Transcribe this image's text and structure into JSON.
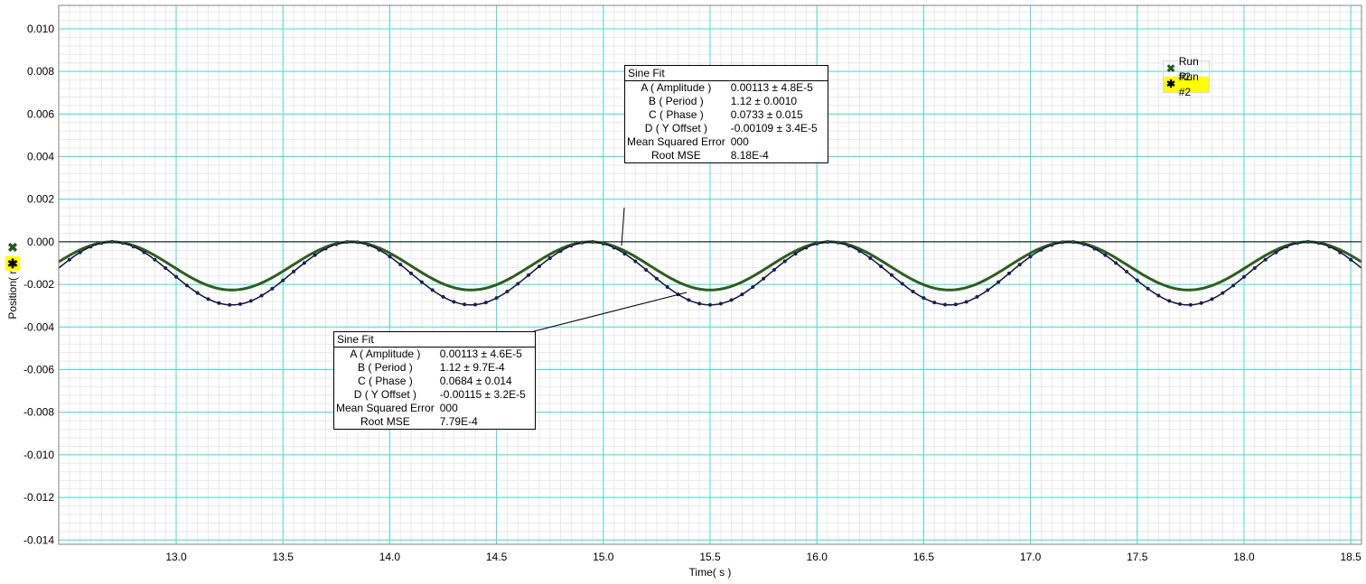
{
  "chart_data": {
    "type": "scatter",
    "xlabel": "Time( s )",
    "ylabel": "Position( m )",
    "xlim": [
      12.45,
      18.55
    ],
    "ylim": [
      -0.0142,
      0.0111
    ],
    "x_ticks": [
      13.0,
      13.5,
      14.0,
      14.5,
      15.0,
      15.5,
      16.0,
      16.5,
      17.0,
      17.5,
      18.0,
      18.5
    ],
    "y_ticks": [
      0.01,
      0.008,
      0.006,
      0.004,
      0.002,
      0.0,
      -0.002,
      -0.004,
      -0.006,
      -0.008,
      -0.01,
      -0.012,
      -0.014
    ],
    "x_tick_labels": [
      "13.0",
      "13.5",
      "14.0",
      "14.5",
      "15.0",
      "15.5",
      "16.0",
      "16.5",
      "17.0",
      "17.5",
      "18.0",
      "18.5"
    ],
    "y_tick_labels": [
      "0.010",
      "0.008",
      "0.006",
      "0.004",
      "0.002",
      "0.000",
      "-0.002",
      "-0.004",
      "-0.006",
      "-0.008",
      "-0.010",
      "-0.012",
      "-0.014"
    ],
    "grid": true,
    "legend_position": "top-right",
    "series": [
      {
        "name": "Run #2",
        "marker": "x",
        "color": "#1f5a1f",
        "fit": {
          "A": 0.00113,
          "B": 1.12,
          "C": 0.0733,
          "D": -0.00109,
          "x0": 12.7,
          "phase_sign": "peak"
        }
      },
      {
        "name": "Run #2",
        "marker": "asterisk",
        "color": "#1a1a66",
        "fit": {
          "A": 0.00113,
          "B": 1.12,
          "C": 0.0684,
          "D": -0.00115,
          "x0": 12.7,
          "phase_sign": "peak",
          "trough_extra": 0.0007
        }
      }
    ]
  },
  "fit_upper": {
    "title": "Sine Fit",
    "rows": [
      {
        "name": "A ( Amplitude )",
        "value": "0.00113 ± 4.8E-5"
      },
      {
        "name": "B ( Period )",
        "value": "1.12 ± 0.0010"
      },
      {
        "name": "C ( Phase )",
        "value": "0.0733 ±  0.015"
      },
      {
        "name": "D ( Y Offset )",
        "value": "-0.00109 ± 3.4E-5"
      },
      {
        "name": "Mean Squared Error",
        "value": "000"
      },
      {
        "name": "Root MSE",
        "value": "8.18E-4"
      }
    ]
  },
  "fit_lower": {
    "title": "Sine Fit",
    "rows": [
      {
        "name": "A ( Amplitude )",
        "value": "0.00113 ± 4.6E-5"
      },
      {
        "name": "B ( Period )",
        "value": "1.12 ± 9.7E-4"
      },
      {
        "name": "C ( Phase )",
        "value": "0.0684 ±  0.014"
      },
      {
        "name": "D ( Y Offset )",
        "value": "-0.00115 ± 3.2E-5"
      },
      {
        "name": "Mean Squared Error",
        "value": "000"
      },
      {
        "name": "Root MSE",
        "value": "7.79E-4"
      }
    ]
  },
  "legend": {
    "items": [
      {
        "label": "Run #2",
        "icon": "x-marker-icon",
        "color": "#1f5a1f",
        "highlight": false
      },
      {
        "label": "Run #2",
        "icon": "asterisk-marker-icon",
        "color": "#000000",
        "highlight": true
      }
    ]
  },
  "side_icons": [
    {
      "icon": "x-marker-icon",
      "color": "#1f5a1f",
      "highlight": false
    },
    {
      "icon": "asterisk-marker-icon",
      "color": "#000000",
      "highlight": true
    }
  ],
  "colors": {
    "grid_major": "#40e0d0",
    "grid_minor": "#e8e8e8",
    "highlight": "#ffff00"
  }
}
